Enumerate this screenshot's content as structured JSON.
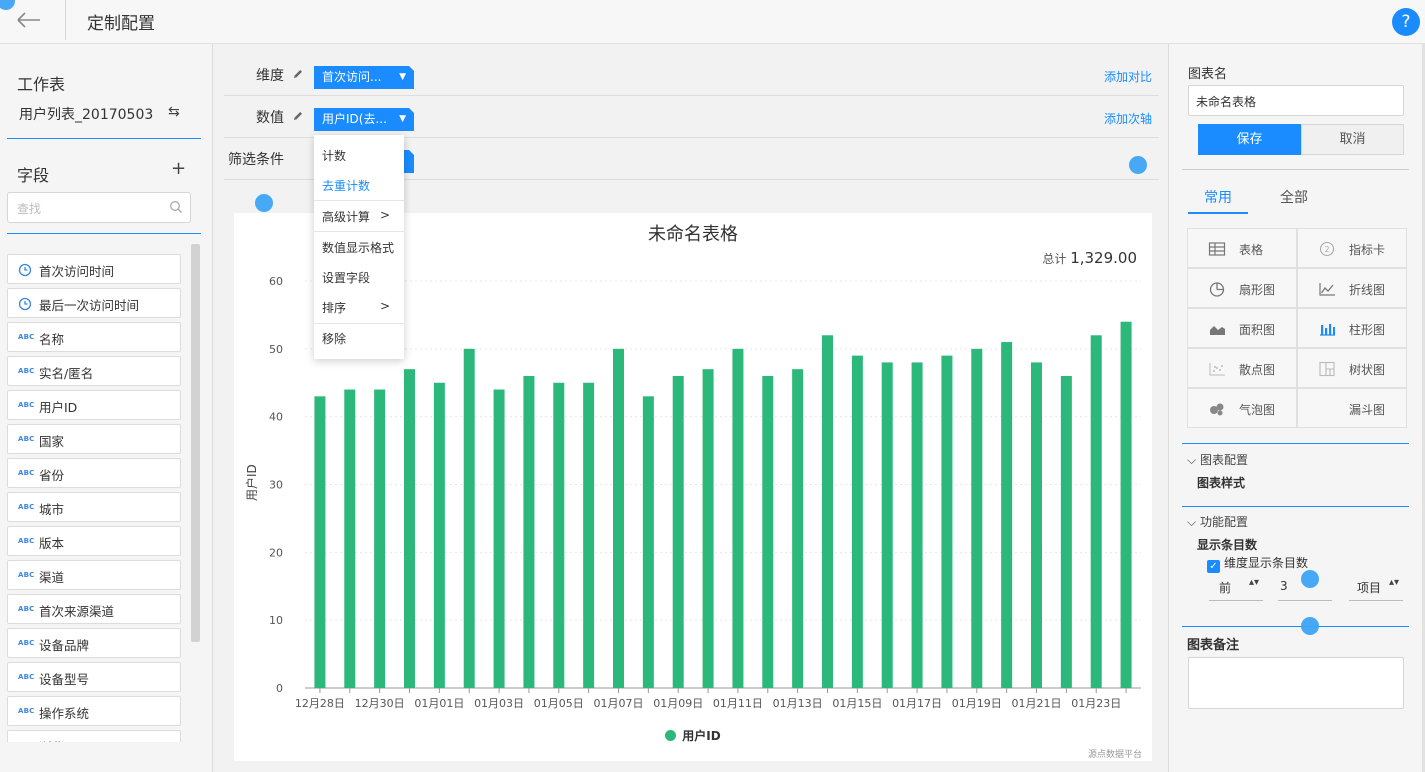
{
  "header": {
    "title": "定制配置",
    "help": "?"
  },
  "left": {
    "worksheet_title": "工作表",
    "worksheet_name": "用户列表_20170503",
    "fields_title": "字段",
    "search_placeholder": "查找",
    "fields": [
      {
        "label": "首次访问时间",
        "type": "time"
      },
      {
        "label": "最后一次访问时间",
        "type": "time"
      },
      {
        "label": "名称",
        "type": "abc"
      },
      {
        "label": "实名/匿名",
        "type": "abc"
      },
      {
        "label": "用户ID",
        "type": "abc"
      },
      {
        "label": "国家",
        "type": "abc"
      },
      {
        "label": "省份",
        "type": "abc"
      },
      {
        "label": "城市",
        "type": "abc"
      },
      {
        "label": "版本",
        "type": "abc"
      },
      {
        "label": "渠道",
        "type": "abc"
      },
      {
        "label": "首次来源渠道",
        "type": "abc"
      },
      {
        "label": "设备品牌",
        "type": "abc"
      },
      {
        "label": "设备型号",
        "type": "abc"
      },
      {
        "label": "操作系统",
        "type": "abc"
      },
      {
        "label": "浏览",
        "type": "abc"
      }
    ],
    "abc_tag": "ABC"
  },
  "config": {
    "dimension_label": "维度",
    "dimension_value": "首次访问...",
    "add_compare": "添加对比",
    "measure_label": "数值",
    "measure_value": "用户ID(去...",
    "add_axis": "添加次轴",
    "filter_label": "筛选条件"
  },
  "dropdown": {
    "items": [
      {
        "label": "计数"
      },
      {
        "label": "去重计数",
        "active": true
      },
      {
        "label": "高级计算",
        "arrow": ">"
      },
      {
        "label": "数值显示格式"
      },
      {
        "label": "设置字段"
      },
      {
        "label": "排序",
        "arrow": ">"
      },
      {
        "label": "移除"
      }
    ]
  },
  "chart": {
    "total_label": "总计",
    "total_value": "1,329.00",
    "watermark": "源点数据平台"
  },
  "chart_data": {
    "type": "bar",
    "title": "未命名表格",
    "xlabel": "",
    "ylabel": "用户ID",
    "ylim": [
      0,
      60
    ],
    "yticks": [
      0,
      10,
      20,
      30,
      40,
      50,
      60
    ],
    "categories": [
      "12月28日",
      "12月29日",
      "12月30日",
      "12月31日",
      "01月01日",
      "01月02日",
      "01月03日",
      "01月04日",
      "01月05日",
      "01月06日",
      "01月07日",
      "01月08日",
      "01月09日",
      "01月10日",
      "01月11日",
      "01月12日",
      "01月13日",
      "01月14日",
      "01月15日",
      "01月16日",
      "01月17日",
      "01月18日",
      "01月19日",
      "01月20日",
      "01月21日",
      "01月22日",
      "01月23日",
      "01月24日"
    ],
    "x_tick_labels_shown": [
      "12月28日",
      "12月30日",
      "01月01日",
      "01月03日",
      "01月05日",
      "01月07日",
      "01月09日",
      "01月11日",
      "01月13日",
      "01月15日",
      "01月17日",
      "01月19日",
      "01月21日",
      "01月23日"
    ],
    "series": [
      {
        "name": "用户ID",
        "color": "#2cb87a",
        "values": [
          43,
          44,
          44,
          47,
          45,
          50,
          44,
          46,
          45,
          45,
          50,
          43,
          46,
          47,
          50,
          46,
          47,
          52,
          49,
          48,
          48,
          49,
          50,
          51,
          48,
          46,
          52,
          54
        ]
      }
    ],
    "legend_position": "bottom",
    "grid": true
  },
  "right": {
    "chart_name_label": "图表名",
    "chart_name_value": "未命名表格",
    "save": "保存",
    "cancel": "取消",
    "tab_common": "常用",
    "tab_all": "全部",
    "chart_types": [
      {
        "label": "表格",
        "icon": "table-icon"
      },
      {
        "label": "指标卡",
        "icon": "metric-card-icon"
      },
      {
        "label": "扇形图",
        "icon": "pie-chart-icon"
      },
      {
        "label": "折线图",
        "icon": "line-chart-icon"
      },
      {
        "label": "面积图",
        "icon": "area-chart-icon"
      },
      {
        "label": "柱形图",
        "icon": "bar-chart-icon"
      },
      {
        "label": "散点图",
        "icon": "scatter-chart-icon"
      },
      {
        "label": "树状图",
        "icon": "treemap-icon"
      },
      {
        "label": "气泡图",
        "icon": "bubble-chart-icon"
      },
      {
        "label": "漏斗图",
        "icon": "funnel-chart-icon"
      }
    ],
    "chart_config": "图表配置",
    "chart_style": "图表样式",
    "func_config": "功能配置",
    "show_count": "显示条目数",
    "dim_show_count": "维度显示条目数",
    "sel_order": "前",
    "sel_num": "3",
    "sel_unit": "项目",
    "note_label": "图表备注"
  },
  "colors": {
    "accent": "#1a8cff",
    "bar": "#2cb87a"
  }
}
